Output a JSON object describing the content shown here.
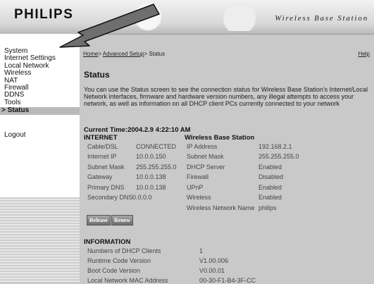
{
  "header": {
    "logo": "PHILIPS",
    "product": "Wireless Base Station"
  },
  "sidebar": {
    "items": [
      "System",
      "Internet Settings",
      "Local Network",
      "Wireless",
      "NAT",
      "Firewall",
      "DDNS",
      "Tools",
      "> Status"
    ],
    "logout": "Logout"
  },
  "breadcrumb": {
    "home": "Home",
    "sep1": ">",
    "advanced": "Advanced Setup",
    "sep2": ">",
    "current": "Status"
  },
  "help": "Help",
  "page_title": "Status",
  "description": "You can use the Status screen to see the connection status for Wireless Base Station's Internet/Local Network interfaces, firmware and hardware version numbers, any illegal attempts to access your network, as well as information on all DHCP client PCs currently connected to your network",
  "current_time": "Current Time:2004.2.9 4:22:10 AM",
  "internet": {
    "heading": "INTERNET",
    "rows": [
      {
        "label": "Cable/DSL",
        "value": "CONNECTED"
      },
      {
        "label": "Internet IP",
        "value": "10.0.0.150"
      },
      {
        "label": "Subnet Mask",
        "value": "255.255.255.0"
      },
      {
        "label": "Gateway",
        "value": "10.0.0.138"
      },
      {
        "label": "Primary DNS",
        "value": "10.0.0.138"
      },
      {
        "label": "Secondary DNS",
        "value": "0.0.0.0"
      }
    ]
  },
  "station": {
    "heading": "Wireless Base Station",
    "rows": [
      {
        "label": "IP Address",
        "value": "192.168.2.1"
      },
      {
        "label": "Subnet Mask",
        "value": "255.255.255.0"
      },
      {
        "label": "DHCP Server",
        "value": "Enabled"
      },
      {
        "label": "Firewall",
        "value": "Disabled"
      },
      {
        "label": "UPnP",
        "value": "Enabled"
      },
      {
        "label": "Wireless",
        "value": "Enabled"
      },
      {
        "label": "Wireless Network Name",
        "value": "philips"
      }
    ]
  },
  "buttons": {
    "release": "Release",
    "renew": "Renew"
  },
  "information": {
    "heading": "INFORMATION",
    "rows": [
      {
        "label": "Numbers of DHCP Clients",
        "value": "1"
      },
      {
        "label": "Runtime Code Version",
        "value": "V1.00.006"
      },
      {
        "label": "Boot Code Version",
        "value": "V0.00.01"
      },
      {
        "label": "Local Network MAC Address",
        "value": "00-30-F1-B4-3F-CC"
      }
    ]
  },
  "colors": {
    "background": "#c9c9c9",
    "sidebar": "#ffffff",
    "active_item": "#b9b9b9",
    "button": "#7a7a7a"
  },
  "icons": [
    "arrow-pointer-icon"
  ]
}
